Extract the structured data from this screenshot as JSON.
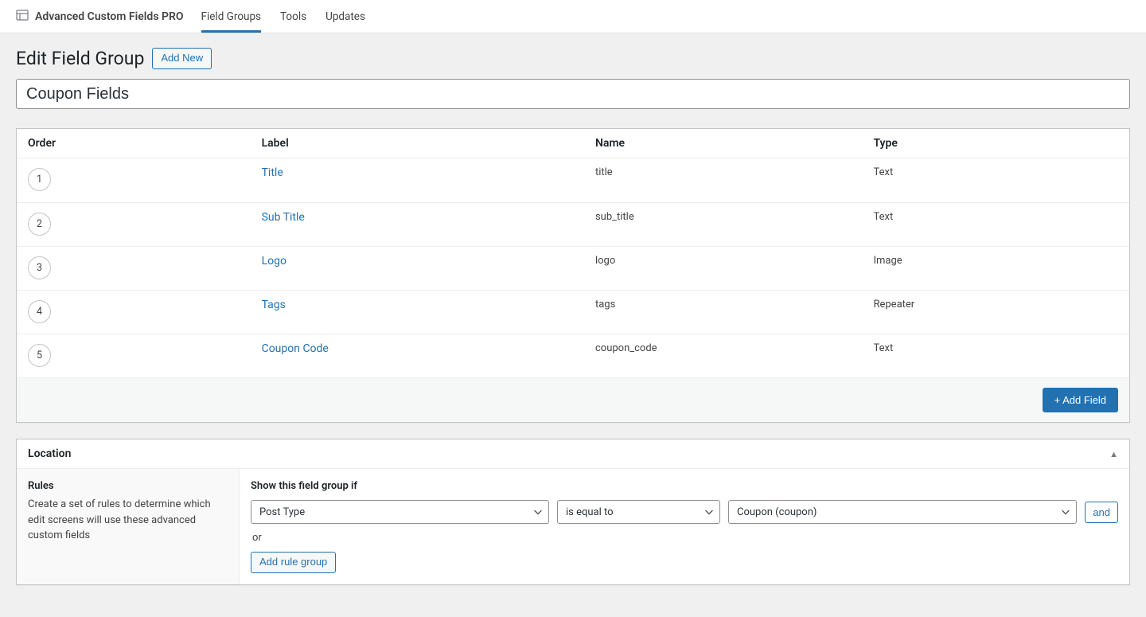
{
  "brand": "Advanced Custom Fields PRO",
  "topnav": [
    {
      "label": "Field Groups",
      "active": true
    },
    {
      "label": "Tools",
      "active": false
    },
    {
      "label": "Updates",
      "active": false
    }
  ],
  "heading": "Edit Field Group",
  "add_new_label": "Add New",
  "title_value": "Coupon Fields",
  "columns": {
    "order": "Order",
    "label": "Label",
    "name": "Name",
    "type": "Type"
  },
  "fields": [
    {
      "order": "1",
      "label": "Title",
      "name": "title",
      "type": "Text"
    },
    {
      "order": "2",
      "label": "Sub Title",
      "name": "sub_title",
      "type": "Text"
    },
    {
      "order": "3",
      "label": "Logo",
      "name": "logo",
      "type": "Image"
    },
    {
      "order": "4",
      "label": "Tags",
      "name": "tags",
      "type": "Repeater"
    },
    {
      "order": "5",
      "label": "Coupon Code",
      "name": "coupon_code",
      "type": "Text"
    }
  ],
  "add_field_label": "+ Add Field",
  "location": {
    "panel_title": "Location",
    "rules_heading": "Rules",
    "rules_desc": "Create a set of rules to determine which edit screens will use these advanced custom fields",
    "show_label": "Show this field group if",
    "rule": {
      "param": "Post Type",
      "operator": "is equal to",
      "value": "Coupon (coupon)",
      "and_label": "and"
    },
    "or_label": "or",
    "add_group_label": "Add rule group"
  }
}
